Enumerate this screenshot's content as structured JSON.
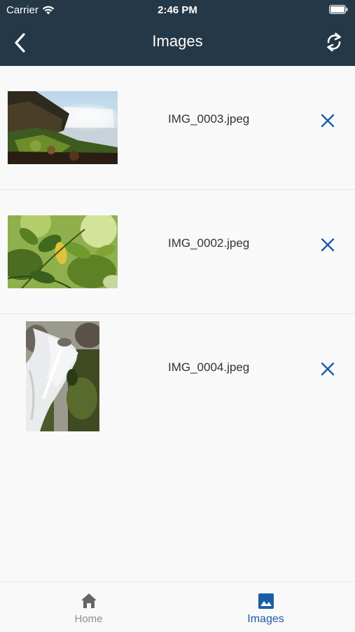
{
  "status_bar": {
    "carrier": "Carrier",
    "time": "2:46 PM"
  },
  "nav": {
    "title": "Images",
    "back_icon": "chevron-left-icon",
    "sync_icon": "sync-icon"
  },
  "images": [
    {
      "filename": "IMG_0003.jpeg"
    },
    {
      "filename": "IMG_0002.jpeg"
    },
    {
      "filename": "IMG_0004.jpeg"
    }
  ],
  "tabbar": {
    "items": [
      {
        "label": "Home",
        "icon": "home-icon",
        "selected": false
      },
      {
        "label": "Images",
        "icon": "image-icon",
        "selected": true
      }
    ]
  },
  "colors": {
    "header_bg": "#253847",
    "accent": "#1a5da8",
    "inactive": "#8e8e8e",
    "background": "#f9f9f9"
  }
}
